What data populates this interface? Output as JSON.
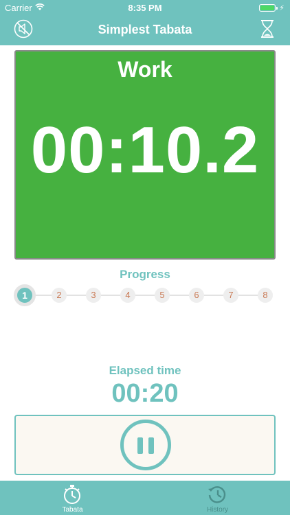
{
  "status_bar": {
    "carrier": "Carrier",
    "time": "8:35 PM"
  },
  "nav": {
    "title": "Simplest Tabata",
    "left_icon": "mute-icon",
    "right_icon": "hourglass-icon"
  },
  "phase": {
    "label": "Work",
    "timer": "00:10.2",
    "color": "#46b140"
  },
  "progress": {
    "title": "Progress",
    "current": 1,
    "steps": [
      "1",
      "2",
      "3",
      "4",
      "5",
      "6",
      "7",
      "8"
    ]
  },
  "elapsed": {
    "label": "Elapsed time",
    "value": "00:20"
  },
  "controls": {
    "pause_icon": "pause-icon"
  },
  "tabs": [
    {
      "label": "Tabata",
      "icon": "stopwatch-icon",
      "active": true
    },
    {
      "label": "History",
      "icon": "history-icon",
      "active": false
    }
  ],
  "colors": {
    "accent": "#6fc2be",
    "work": "#46b140",
    "step_text": "#c97a55"
  }
}
